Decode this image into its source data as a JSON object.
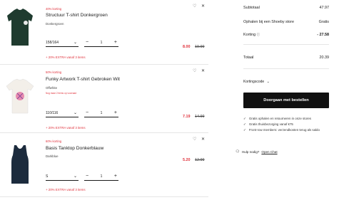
{
  "cart": {
    "items": [
      {
        "discount": "40% korting",
        "name": "Structuur T-shirt Donkergroen",
        "color": "Donkergroen",
        "note": "",
        "size": "158/164",
        "quantity": "1",
        "price_new": "8.00",
        "price_old": "19.99",
        "extra": "+ 20% EXTRA vanaf 3 items",
        "image": "dark-green-long-sleeve-shirt"
      },
      {
        "discount": "50% korting",
        "name": "Funky Artwork T-shirt Gebroken Wit",
        "color": "Offwhite",
        "note": "Nog maar 2 items op voorraad",
        "size": "110/116",
        "quantity": "1",
        "price_new": "7.19",
        "price_old": "14.99",
        "extra": "+ 20% EXTRA vanaf 3 items",
        "image": "off-white-tshirt-with-print"
      },
      {
        "discount": "60% korting",
        "name": "Basis Tanktop Donkerblauw",
        "color": "Darkblue",
        "note": "",
        "size": "S",
        "quantity": "1",
        "price_new": "5.20",
        "price_old": "12.99",
        "extra": "+ 20% EXTRA vanaf 3 items",
        "image": "dark-blue-tank-top"
      }
    ]
  },
  "summary": {
    "subtotal_label": "Subtotaal",
    "subtotal_value": "47.97",
    "pickup_label": "Ophalen bij een Shoeby store",
    "pickup_value": "Gratis",
    "discount_label": "Korting",
    "discount_value": "- 27.58",
    "total_label": "Totaal",
    "total_value": "20.39",
    "promo_label": "Kortingscode",
    "checkout_label": "Doorgaan met bestellen",
    "perks": [
      "Gratis ophalen en retourneren in onze stores",
      "Gratis thuisbezorging vanaf €75",
      "Front-row members: verzendkosten terug als saldo"
    ],
    "help_text": "Hulp nodig?",
    "help_link": "Open Chat"
  },
  "colors": {
    "accent_red": "#e0323c",
    "button_black": "#111111",
    "shirt_green": "#1f3b2f",
    "tank_blue": "#1c2b3d"
  },
  "icons": [
    "heart-icon",
    "close-icon",
    "chevron-down-icon",
    "minus-icon",
    "plus-icon",
    "info-icon",
    "check-icon",
    "chat-icon"
  ]
}
